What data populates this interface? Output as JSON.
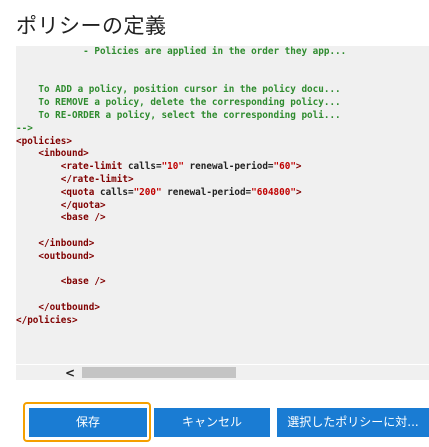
{
  "page": {
    "title": "ポリシーの定義"
  },
  "editor": {
    "lines": [
      [
        {
          "c": "cm",
          "t": "            - Policies are applied in the order they app..."
        }
      ],
      [
        {
          "c": "cm",
          "t": ""
        }
      ],
      [
        {
          "c": "cm",
          "t": ""
        }
      ],
      [
        {
          "c": "cm",
          "t": "    To ADD a policy, position cursor in the policy docu..."
        }
      ],
      [
        {
          "c": "cm",
          "t": "    To REMOVE a policy, delete the corresponding policy..."
        }
      ],
      [
        {
          "c": "cm",
          "t": "    To RE-ORDER a policy, select the corresponding poli..."
        }
      ],
      [
        {
          "c": "cm",
          "t": "-->"
        }
      ],
      [
        {
          "c": "tg",
          "t": "<policies>"
        }
      ],
      [
        {
          "c": "tg",
          "t": "    <inbound>"
        }
      ],
      [
        {
          "c": "tg",
          "t": "        <rate-limit"
        },
        {
          "c": "at",
          "t": " calls"
        },
        {
          "c": "eq",
          "t": "="
        },
        {
          "c": "vl",
          "t": "\"10\""
        },
        {
          "c": "at",
          "t": " renewal-period"
        },
        {
          "c": "eq",
          "t": "="
        },
        {
          "c": "vl",
          "t": "\"60\""
        },
        {
          "c": "tg",
          "t": ">"
        }
      ],
      [
        {
          "c": "tg",
          "t": "        </rate-limit>"
        }
      ],
      [
        {
          "c": "tg",
          "t": "        <quota"
        },
        {
          "c": "at",
          "t": " calls"
        },
        {
          "c": "eq",
          "t": "="
        },
        {
          "c": "vl",
          "t": "\"200\""
        },
        {
          "c": "at",
          "t": " renewal-period"
        },
        {
          "c": "eq",
          "t": "="
        },
        {
          "c": "vl",
          "t": "\"604800\""
        },
        {
          "c": "tg",
          "t": ">"
        }
      ],
      [
        {
          "c": "tg",
          "t": "        </quota>"
        }
      ],
      [
        {
          "c": "tg",
          "t": "        <base />"
        }
      ],
      [
        {
          "c": "tg",
          "t": ""
        }
      ],
      [
        {
          "c": "tg",
          "t": "    </inbound>"
        }
      ],
      [
        {
          "c": "tg",
          "t": "    <outbound>"
        }
      ],
      [
        {
          "c": "tg",
          "t": ""
        }
      ],
      [
        {
          "c": "tg",
          "t": "        <base />"
        }
      ],
      [
        {
          "c": "tg",
          "t": ""
        }
      ],
      [
        {
          "c": "tg",
          "t": "    </outbound>"
        }
      ],
      [
        {
          "c": "tg",
          "t": "</policies>"
        }
      ]
    ]
  },
  "scrollbar": {
    "left_arrow": "<"
  },
  "buttons": {
    "save": "保存",
    "cancel": "キャンセル",
    "apply": "選択したポリシーに対..."
  },
  "colors": {
    "button_bg": "#1a7cd3",
    "focus_ring": "#f5a000",
    "comment": "#2e8b2e",
    "tag": "#800000",
    "attr_value": "#c00000"
  }
}
